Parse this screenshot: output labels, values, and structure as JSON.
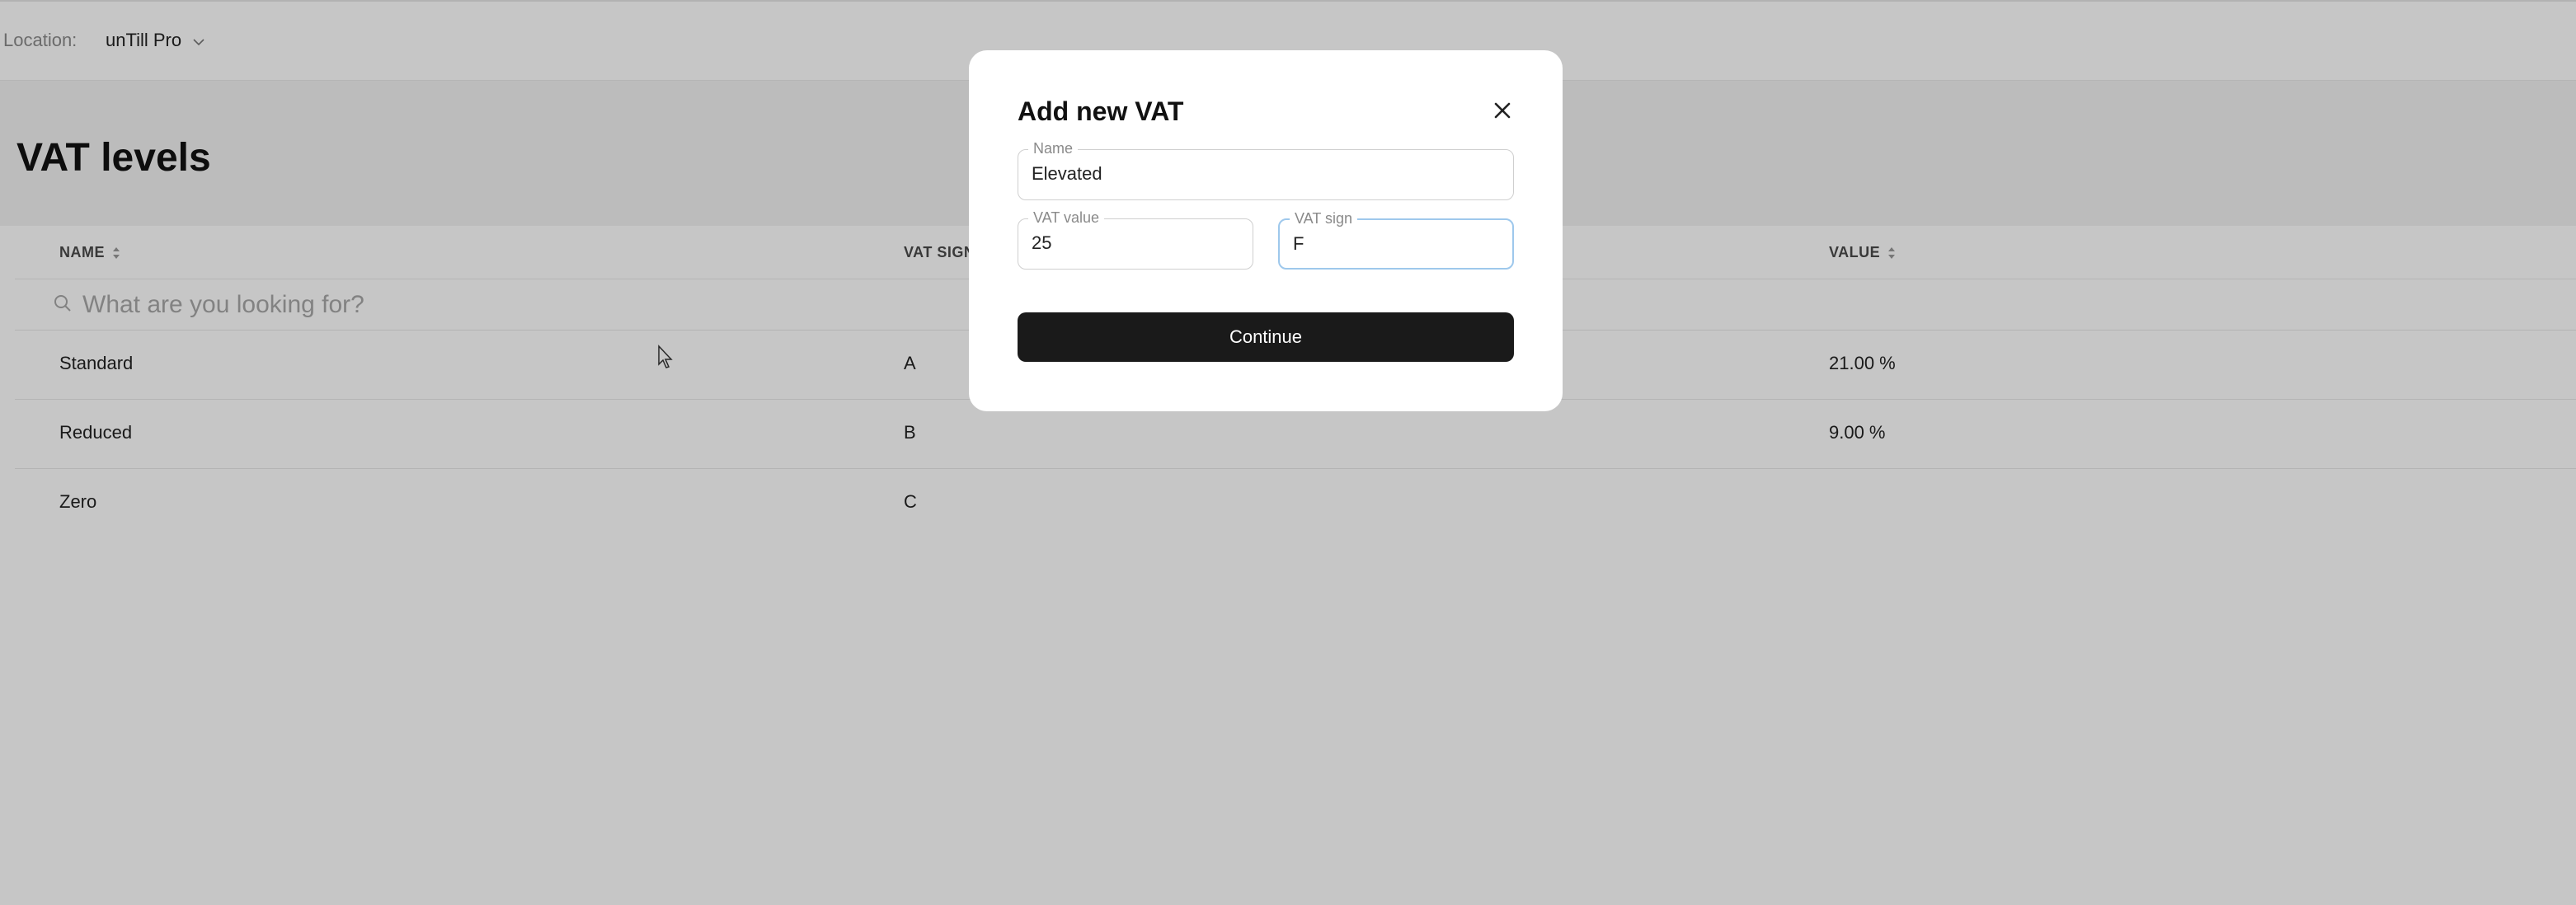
{
  "topbar": {
    "location_label": "Location:",
    "location_value": "unTill Pro"
  },
  "page": {
    "title": "VAT levels"
  },
  "table": {
    "columns": [
      "NAME",
      "VAT SIGN",
      "VALUE"
    ],
    "search_placeholder": "What are you looking for?",
    "rows": [
      {
        "name": "Standard",
        "sign": "A",
        "value": "21.00 %"
      },
      {
        "name": "Reduced",
        "sign": "B",
        "value": "9.00 %"
      },
      {
        "name": "Zero",
        "sign": "C",
        "value": ""
      }
    ]
  },
  "modal": {
    "title": "Add new VAT",
    "name_label": "Name",
    "name_value": "Elevated",
    "vat_value_label": "VAT value",
    "vat_value": "25",
    "vat_sign_label": "VAT sign",
    "vat_sign": "F",
    "continue_label": "Continue"
  },
  "colors": {
    "overlay": "rgba(0,0,0,0.225)",
    "primary_button": "#1a1a1a",
    "focus_border": "#9ec8ec"
  }
}
